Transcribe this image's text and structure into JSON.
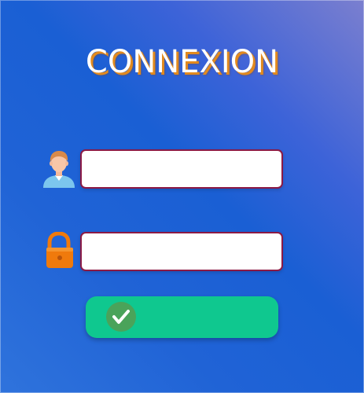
{
  "form": {
    "title": "CONNEXION",
    "username": {
      "value": "",
      "placeholder": ""
    },
    "password": {
      "value": "",
      "placeholder": ""
    },
    "submit": {
      "icon": "check-icon"
    }
  },
  "icons": {
    "user": "user-avatar-icon",
    "lock": "lock-icon"
  },
  "colors": {
    "title_shadow": "#e28a1e",
    "input_border": "#8c1a45",
    "submit_bg": "#0fc88f",
    "check_badge": "#4aa35a",
    "lock_body": "#f07a0c"
  }
}
